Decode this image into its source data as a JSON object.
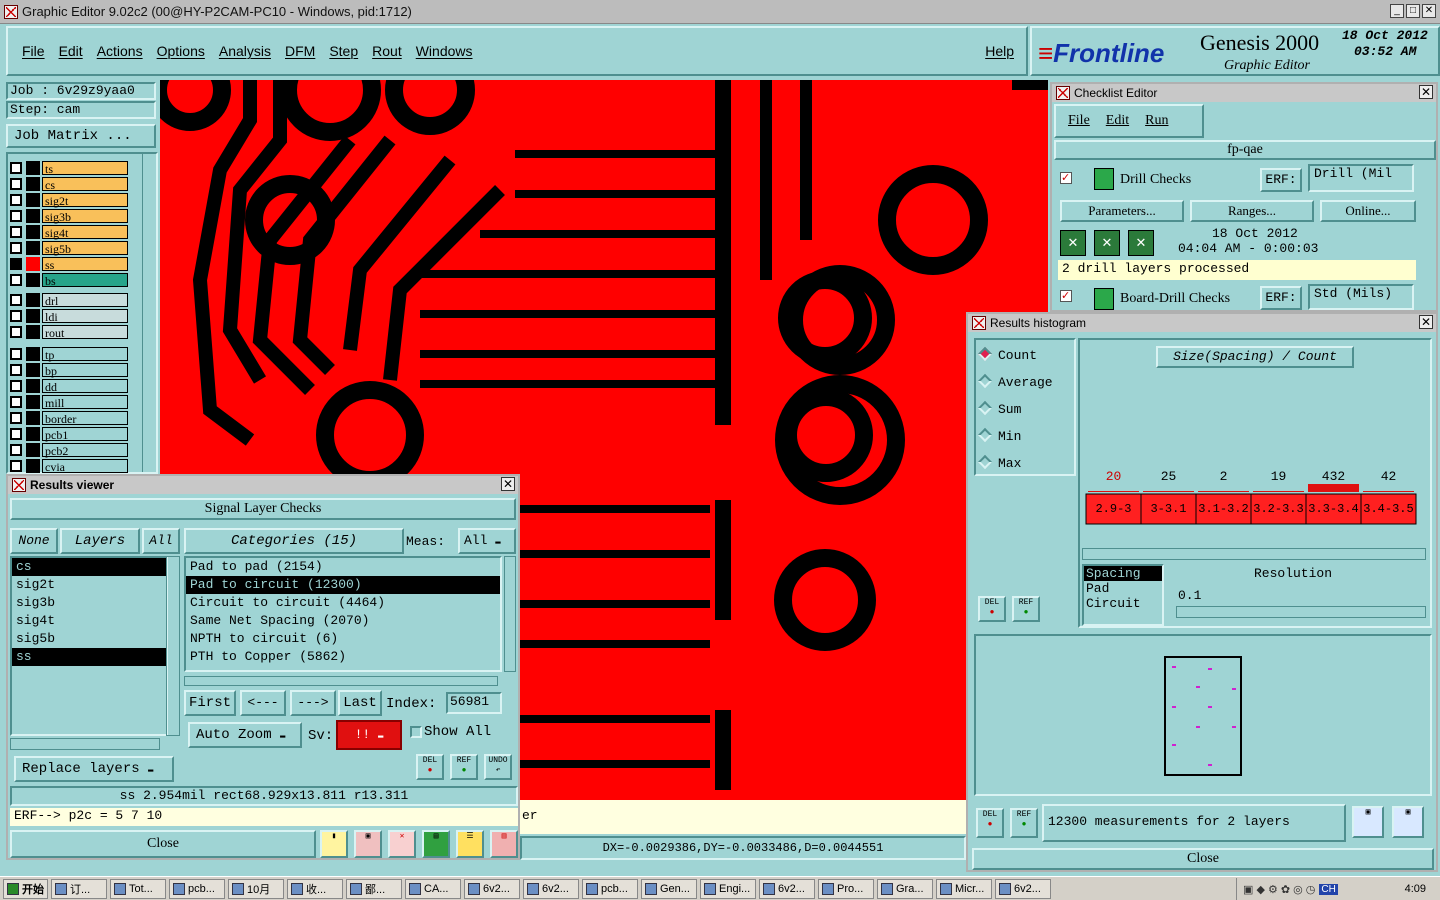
{
  "window": {
    "title": "Graphic Editor 9.02c2 (00@HY-P2CAM-PC10 - Windows, pid:1712)"
  },
  "menu": {
    "items": [
      "File",
      "Edit",
      "Actions",
      "Options",
      "Analysis",
      "DFM",
      "Step",
      "Rout",
      "Windows"
    ],
    "help": "Help"
  },
  "brand": {
    "logo": "Frontline",
    "product": "Genesis 2000",
    "sub": "Graphic Editor",
    "date": "18 Oct 2012",
    "time": "03:52 AM"
  },
  "job": {
    "job_label": "Job : 6v29z9yaa0",
    "step_label": "Step: cam",
    "matrix_button": "Job Matrix ..."
  },
  "layers": {
    "group1": [
      {
        "name": "ts",
        "color": "#f9c05a"
      },
      {
        "name": "cs",
        "color": "#f9c05a"
      },
      {
        "name": "sig2t",
        "color": "#f9c05a"
      },
      {
        "name": "sig3b",
        "color": "#f9c05a"
      },
      {
        "name": "sig4t",
        "color": "#f9c05a"
      },
      {
        "name": "sig5b",
        "color": "#f9c05a"
      },
      {
        "name": "ss",
        "color": "#f9c05a",
        "active": true
      },
      {
        "name": "bs",
        "color": "#27a48a"
      }
    ],
    "group2": [
      {
        "name": "drl"
      },
      {
        "name": "ldi"
      },
      {
        "name": "rout"
      }
    ],
    "group3": [
      {
        "name": "tp"
      },
      {
        "name": "bp"
      },
      {
        "name": "dd"
      },
      {
        "name": "mill"
      },
      {
        "name": "border"
      },
      {
        "name": "pcb1"
      },
      {
        "name": "pcb2"
      },
      {
        "name": "cvia"
      }
    ]
  },
  "checklist": {
    "title": "Checklist Editor",
    "menu": [
      "File",
      "Edit",
      "Run"
    ],
    "name": "fp-qae",
    "drill": {
      "label": "Drill Checks",
      "erf_label": "ERF:",
      "erf_value": "Drill (Mil",
      "buttons": [
        "Parameters...",
        "Ranges...",
        "Online..."
      ],
      "date": "18 Oct 2012",
      "time": "04:04 AM - 0:00:03",
      "status": "2 drill layers processed"
    },
    "board": {
      "label": "Board-Drill Checks",
      "erf_label": "ERF:",
      "erf_value": "Std (Mils)"
    }
  },
  "histogram": {
    "title": "Results histogram",
    "modes": [
      "Count",
      "Average",
      "Sum",
      "Min",
      "Max"
    ],
    "heading": "Size(Spacing) / Count",
    "chart_data": {
      "type": "bar",
      "categories": [
        "2.9-3",
        "3-3.1",
        "3.1-3.2",
        "3.2-3.3",
        "3.3-3.4",
        "3.4-3.5"
      ],
      "values": [
        20,
        25,
        2,
        19,
        432,
        42
      ]
    },
    "list": [
      "Spacing",
      "Pad",
      "Circuit"
    ],
    "resolution_label": "Resolution",
    "resolution_value": "0.1",
    "summary": "12300 measurements for 2 layers",
    "close": "Close",
    "del": "DEL",
    "ref": "REF"
  },
  "results": {
    "title": "Results viewer",
    "header": "Signal Layer Checks",
    "none": "None",
    "layers_btn": "Layers",
    "all": "All",
    "categories_btn": "Categories (15)",
    "meas_label": "Meas:",
    "meas_value": "All",
    "layer_list": [
      {
        "name": "cs",
        "sel": true
      },
      {
        "name": "sig2t"
      },
      {
        "name": "sig3b"
      },
      {
        "name": "sig4t"
      },
      {
        "name": "sig5b"
      },
      {
        "name": "ss",
        "sel": true
      }
    ],
    "categories": [
      {
        "name": "Pad to pad (2154)"
      },
      {
        "name": "Pad to circuit (12300)",
        "sel": true
      },
      {
        "name": "Circuit to circuit (4464)"
      },
      {
        "name": "Same Net Spacing (2070)"
      },
      {
        "name": "NPTH to circuit (6)"
      },
      {
        "name": "PTH to Copper (5862)"
      }
    ],
    "nav": [
      "First",
      "<---",
      "--->",
      "Last"
    ],
    "index_label": "Index:",
    "index_value": "56981",
    "autozoom": "Auto Zoom",
    "sv_label": "Sv:",
    "sv_value": "!!",
    "show_all": "Show All",
    "replace": "Replace layers",
    "info": "ss 2.954mil   rect68.929x13.811   r13.311",
    "erf": "ERF--> p2c = 5 7 10",
    "close": "Close",
    "small_btns": [
      "DEL",
      "REF",
      "UNDO"
    ]
  },
  "statusbar": {
    "coords": "DX=-0.0029386,DY=-0.0033486,D=0.0044551",
    "msg_tail": "er"
  },
  "taskbar": {
    "start": "开始",
    "items": [
      "订...",
      "Tot...",
      "pcb...",
      "10月",
      "收...",
      "鄙...",
      "CA...",
      "6v2...",
      "6v2...",
      "pcb...",
      "Gen...",
      "Engi...",
      "6v2...",
      "Pro...",
      "Gra...",
      "Micr...",
      "6v2..."
    ],
    "clock": "4:09"
  }
}
